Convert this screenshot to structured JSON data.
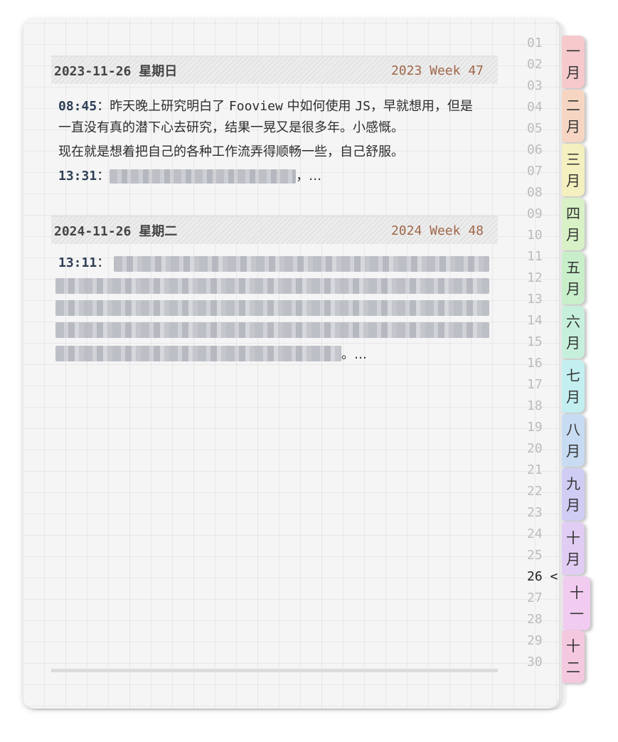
{
  "entries": [
    {
      "date": "2023-11-26 星期日",
      "week": "2023 Week 47",
      "time1": "08:45",
      "text1_a": "昨天晚上研究明白了 ",
      "text1_code1": "Fooview",
      "text1_b": " 中如何使用 ",
      "text1_code2": "JS",
      "text1_c": "，早就想用，但是一直没有真的潜下心去研究，结果一晃又是很多年。小感慨。",
      "text2": "现在就是想着把自己的各种工作流弄得顺畅一些，自己舒服。",
      "time2": "13:31",
      "tail2": "，…"
    },
    {
      "date": "2024-11-26 星期二",
      "week": "2024 Week 48",
      "time1": "13:11",
      "tail1": "。…"
    }
  ],
  "days": [
    "01",
    "02",
    "03",
    "04",
    "05",
    "06",
    "07",
    "08",
    "09",
    "10",
    "11",
    "12",
    "13",
    "14",
    "15",
    "16",
    "17",
    "18",
    "19",
    "20",
    "21",
    "22",
    "23",
    "24",
    "25",
    "26 <",
    "27",
    "28",
    "29",
    "30"
  ],
  "current_day": "26",
  "months": [
    {
      "top": "一",
      "bottom": "月",
      "color": "#f6c9cc"
    },
    {
      "top": "二",
      "bottom": "月",
      "color": "#f6d6c3"
    },
    {
      "top": "三",
      "bottom": "月",
      "color": "#f4f0bf"
    },
    {
      "top": "四",
      "bottom": "月",
      "color": "#d9f1c6"
    },
    {
      "top": "五",
      "bottom": "月",
      "color": "#c8efc9"
    },
    {
      "top": "六",
      "bottom": "月",
      "color": "#c7f0dc"
    },
    {
      "top": "七",
      "bottom": "月",
      "color": "#c3eff0"
    },
    {
      "top": "八",
      "bottom": "月",
      "color": "#c7dcf2"
    },
    {
      "top": "九",
      "bottom": "月",
      "color": "#cfcdf4"
    },
    {
      "top": "十",
      "bottom": "月",
      "color": "#e1ccf3"
    },
    {
      "top": "十",
      "bottom": "一",
      "color": "#f2ccf0"
    },
    {
      "top": "十",
      "bottom": "二",
      "color": "#f4c9df"
    }
  ]
}
